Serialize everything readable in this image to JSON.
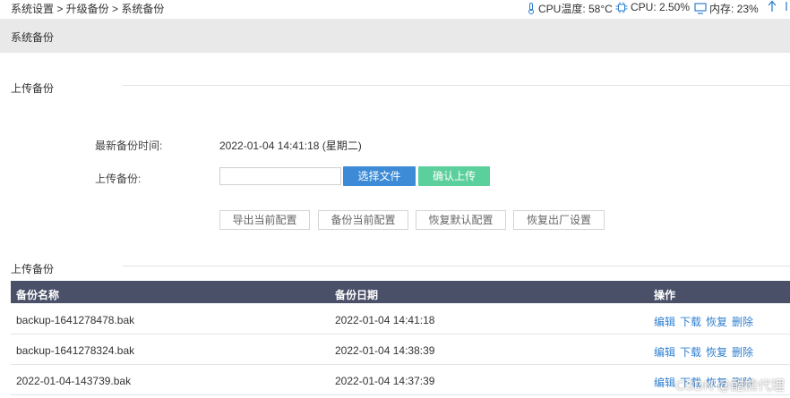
{
  "breadcrumb": "系统设置 > 升级备份 > 系统备份",
  "status": {
    "cpu_temp": "CPU温度: 58°C",
    "cpu_usage": "CPU: 2.50%",
    "memory": "内存: 23%"
  },
  "page_title": "系统备份",
  "upload_section": {
    "title": "上传备份",
    "last_backup_label": "最新备份时间:",
    "last_backup_value": "2022-01-04 14:41:18 (星期二)",
    "upload_label": "上传备份:",
    "choose_file_label": "选择文件",
    "confirm_upload_label": "确认上传",
    "actions": [
      "导出当前配置",
      "备份当前配置",
      "恢复默认配置",
      "恢复出厂设置"
    ]
  },
  "list_section": {
    "title": "上传备份",
    "columns": [
      "备份名称",
      "备份日期",
      "操作"
    ],
    "rows": [
      {
        "name": "backup-1641278478.bak",
        "date": "2022-01-04 14:41:18"
      },
      {
        "name": "backup-1641278324.bak",
        "date": "2022-01-04 14:38:39"
      },
      {
        "name": "2022-01-04-143739.bak",
        "date": "2022-01-04 14:37:39"
      }
    ],
    "row_actions": [
      "编辑",
      "下载",
      "恢复",
      "删除"
    ]
  },
  "watermark": "CSDN @酷熊代理",
  "colors": {
    "accent_blue": "#3d8bd6",
    "accent_green": "#5bcf9c",
    "table_header": "#4a5068",
    "link": "#2f7fd0",
    "title_band": "#e9e9e9"
  }
}
